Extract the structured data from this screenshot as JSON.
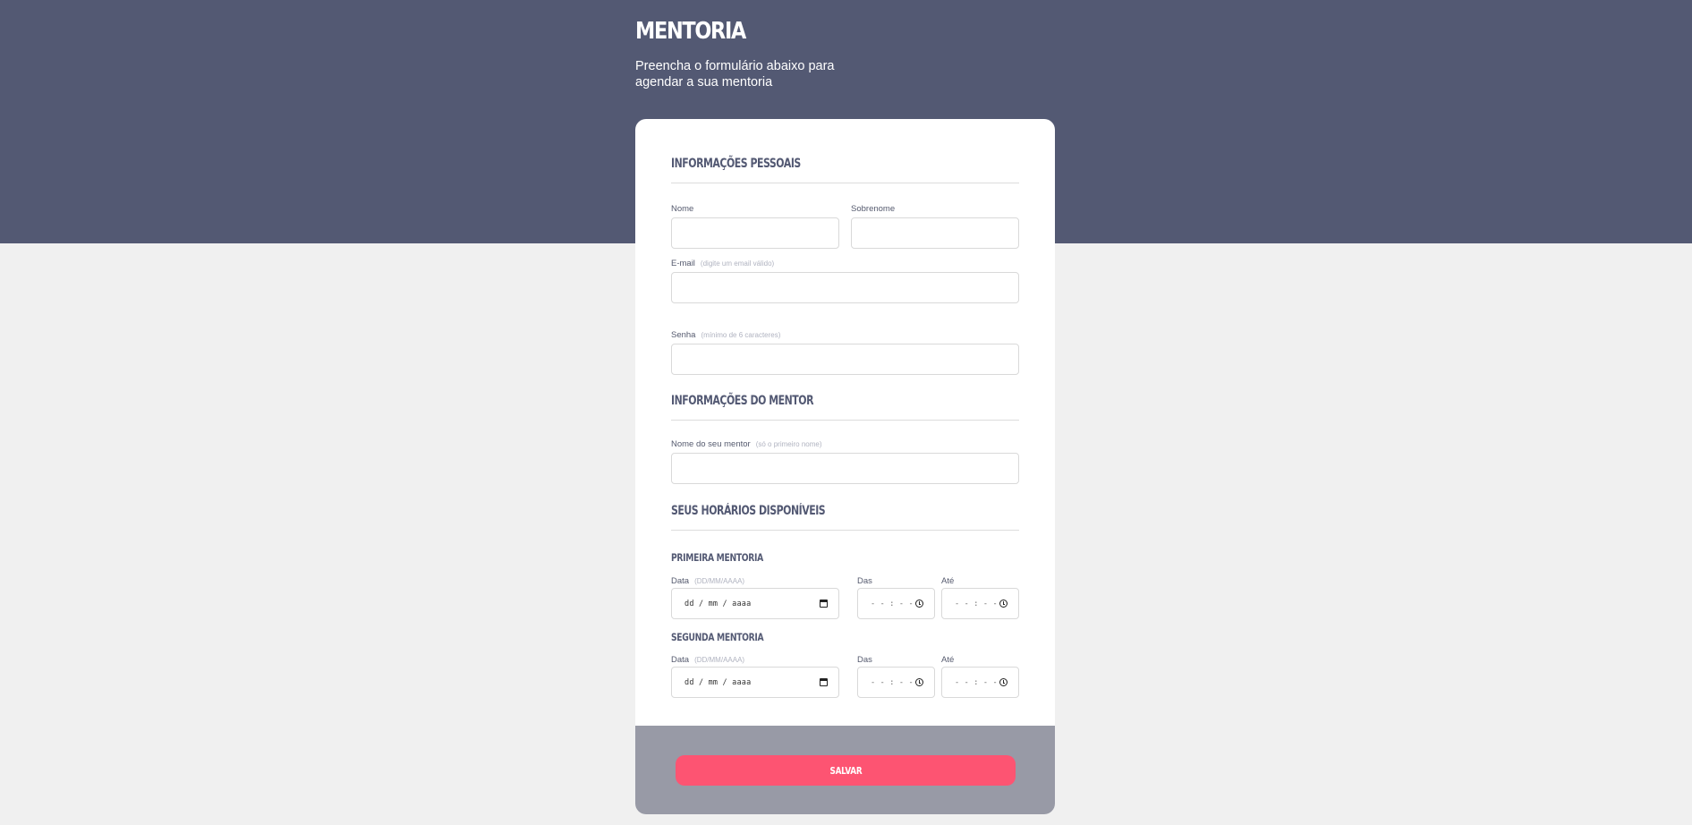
{
  "header": {
    "title": "MENTORIA",
    "subtitle": "Preencha o formulário abaixo para agendar a sua mentoria"
  },
  "personal": {
    "section_title": "INFORMAÇÕES PESSOAIS",
    "first_name_label": "Nome",
    "last_name_label": "Sobrenome",
    "email_label": "E-mail",
    "email_hint": "(digite um email válido)",
    "password_label": "Senha",
    "password_hint": "(mínimo de 6 caracteres)",
    "first_name_value": "",
    "last_name_value": "",
    "email_value": "",
    "password_value": ""
  },
  "mentor": {
    "section_title": "INFORMAÇÕES DO MENTOR",
    "name_label": "Nome do seu mentor",
    "name_hint": "(só o primeiro nome)",
    "name_value": ""
  },
  "schedule": {
    "section_title": "SEUS HORÁRIOS DISPONÍVEIS",
    "first": {
      "title": "PRIMEIRA MENTORIA",
      "date_label": "Data",
      "date_hint": "(DD/MM/AAAA)",
      "date_placeholder": "dd / mm / aaaa",
      "from_label": "Das",
      "from_placeholder": "- - : - -",
      "to_label": "Até",
      "to_placeholder": "- - : - -"
    },
    "second": {
      "title": "SEGUNDA MENTORIA",
      "date_label": "Data",
      "date_hint": "(DD/MM/AAAA)",
      "date_placeholder": "dd / mm / aaaa",
      "from_label": "Das",
      "from_placeholder": "- - : - -",
      "to_label": "Até",
      "to_placeholder": "- - : - -"
    }
  },
  "footer": {
    "save_label": "SALVAR"
  },
  "colors": {
    "header_bg": "#535973",
    "page_bg": "#f0f0f0",
    "footer_bg": "#989aa6",
    "accent": "#fd5472"
  }
}
